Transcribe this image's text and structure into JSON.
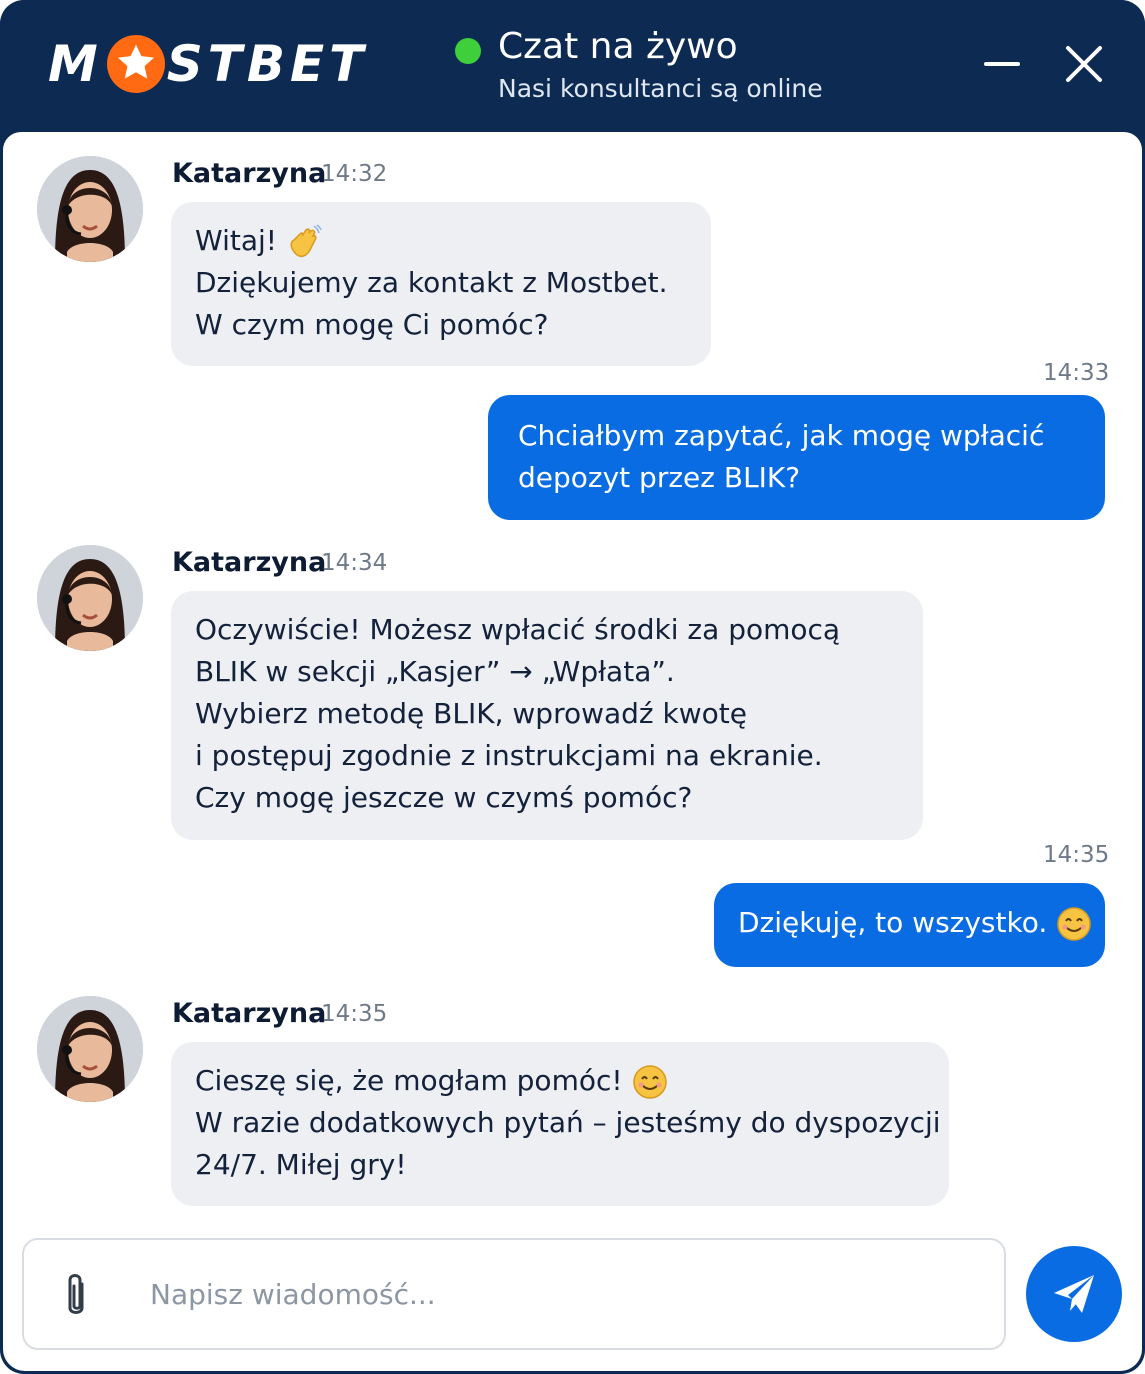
{
  "header": {
    "logo_left": "M",
    "logo_right": "STBET",
    "title": "Czat na żywo",
    "subtitle": "Nasi konsultanci są online",
    "status_color": "#3ecf3a",
    "brand_color": "#0d2a52",
    "accent_color": "#ff6a13"
  },
  "messages": [
    {
      "from": "agent",
      "name": "Katarzyna",
      "time": "14:32",
      "lines": [
        "Witaj!",
        "Dziękujemy za kontakt z Mostbet.",
        "W czym mogę Ci pomóc?"
      ],
      "emoji": "waving-hand-icon"
    },
    {
      "from": "user",
      "time": "14:33",
      "lines": [
        "Chciałbym zapytać, jak mogę wpłacić",
        "depozyt przez BLIK?"
      ]
    },
    {
      "from": "agent",
      "name": "Katarzyna",
      "time": "14:34",
      "lines": [
        "Oczywiście! Możesz wpłacić środki za pomocą",
        "BLIK w sekcji „Kasjer” → „Wpłata”.",
        "Wybierz metodę BLIK, wprowadź kwotę",
        "i postępuj zgodnie z instrukcjami na ekranie.",
        "Czy mogę jeszcze w czymś pomóc?"
      ]
    },
    {
      "from": "user",
      "time": "14:35",
      "lines": [
        "Dziękuję, to wszystko."
      ],
      "emoji": "smiling-face-icon"
    },
    {
      "from": "agent",
      "name": "Katarzyna",
      "time": "14:35",
      "lines": [
        "Cieszę się, że mogłam pomóc!",
        "W razie dodatkowych pytań – jesteśmy do dyspozycji",
        "24/7. Miłej gry!"
      ],
      "emoji": "smiling-face-icon"
    }
  ],
  "composer": {
    "placeholder": "Napisz wiadomość...",
    "value": ""
  },
  "icons": {
    "minimize": "minimize-icon",
    "close": "close-icon",
    "attach": "paperclip-icon",
    "send": "send-icon"
  },
  "colors": {
    "user_bubble": "#0a6ce3",
    "agent_bubble": "#edeff3"
  }
}
